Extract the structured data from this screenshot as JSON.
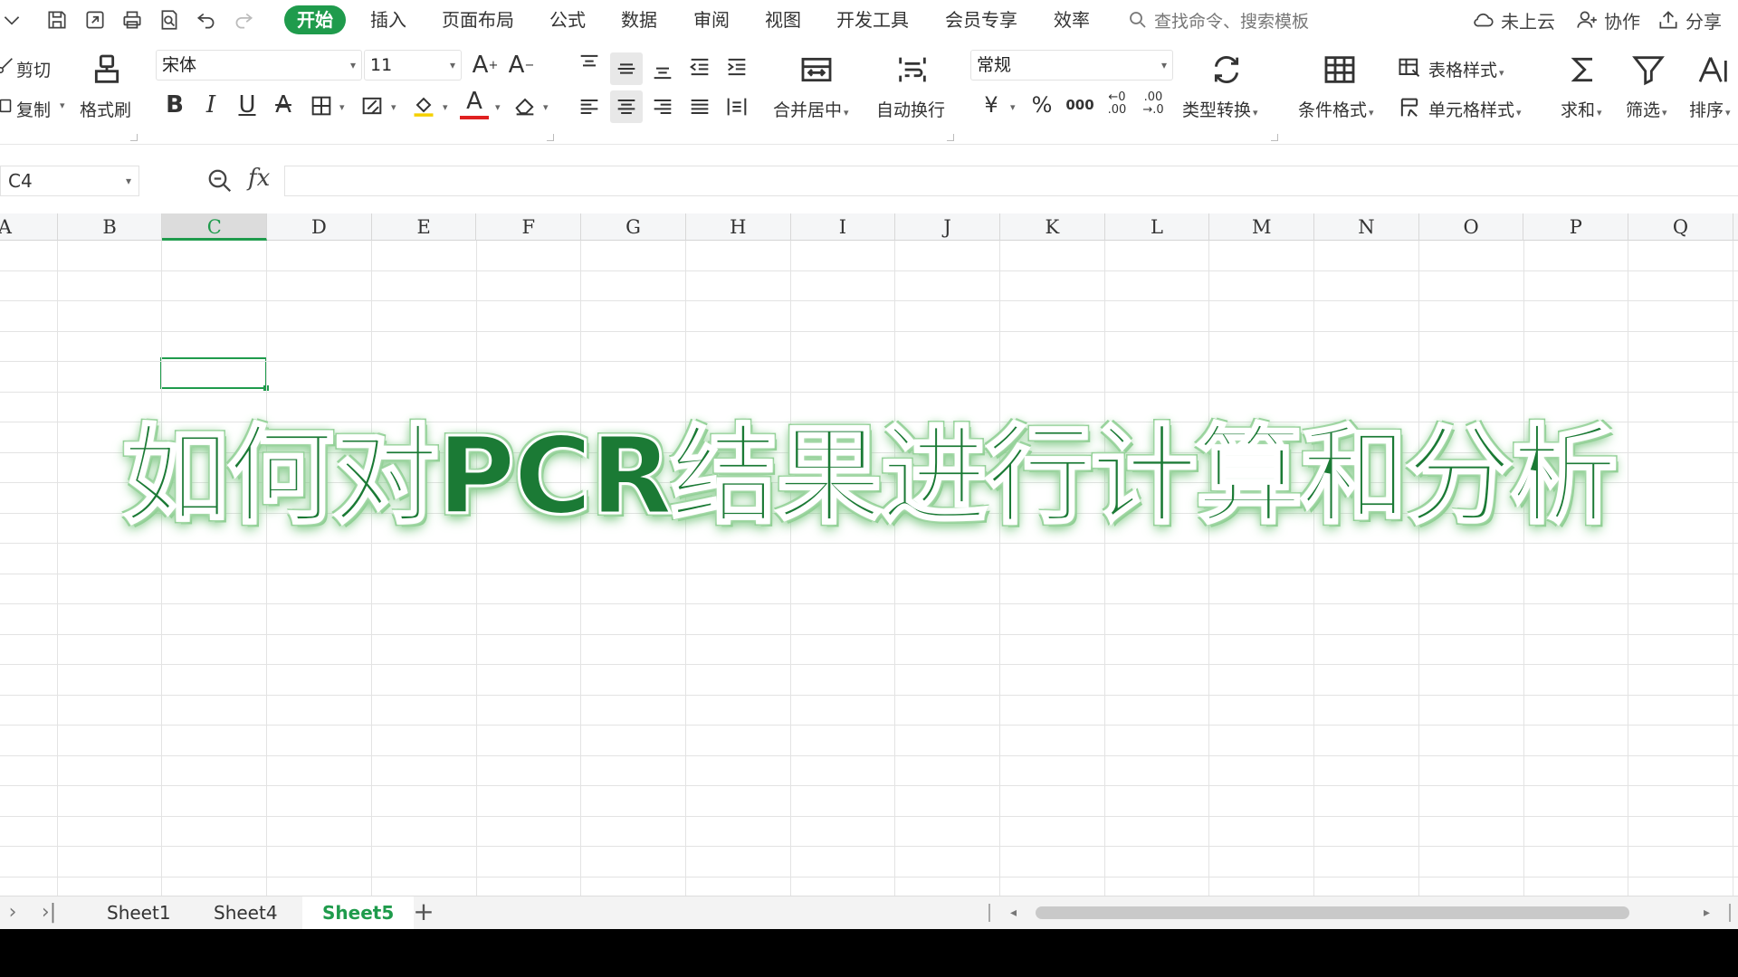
{
  "menu": {
    "tabs": [
      "开始",
      "插入",
      "页面布局",
      "公式",
      "数据",
      "审阅",
      "视图",
      "开发工具",
      "会员专享",
      "效率"
    ],
    "active_tab": "开始",
    "search_placeholder": "查找命令、搜索模板",
    "right": {
      "cloud": "未上云",
      "collab": "协作",
      "share": "分享"
    }
  },
  "ribbon": {
    "cut": "剪切",
    "copy": "复制",
    "format_painter": "格式刷",
    "font_name": "宋体",
    "font_size": "11",
    "merge_center": "合并居中",
    "wrap_text": "自动换行",
    "number_format": "常规",
    "type_convert": "类型转换",
    "cond_format": "条件格式",
    "table_style": "表格样式",
    "cell_style": "单元格样式",
    "sum": "求和",
    "filter": "筛选",
    "sort": "排序",
    "percent_symbol": "%",
    "currency_symbol": "¥"
  },
  "formula_bar": {
    "name_box": "C4",
    "fx_label": "fx",
    "value": ""
  },
  "grid": {
    "columns": [
      "A",
      "B",
      "C",
      "D",
      "E",
      "F",
      "G",
      "H",
      "I",
      "J",
      "K",
      "L",
      "M",
      "N",
      "O",
      "P",
      "Q"
    ],
    "active_column": "C",
    "active_cell": "C4"
  },
  "overlay_title": "如何对PCR结果进行计算和分析",
  "sheets": {
    "tabs": [
      "Sheet1",
      "Sheet4",
      "Sheet5"
    ],
    "active": "Sheet5"
  },
  "colors": {
    "accent": "#1f9b4c",
    "title_fill": "#1b7a35"
  }
}
